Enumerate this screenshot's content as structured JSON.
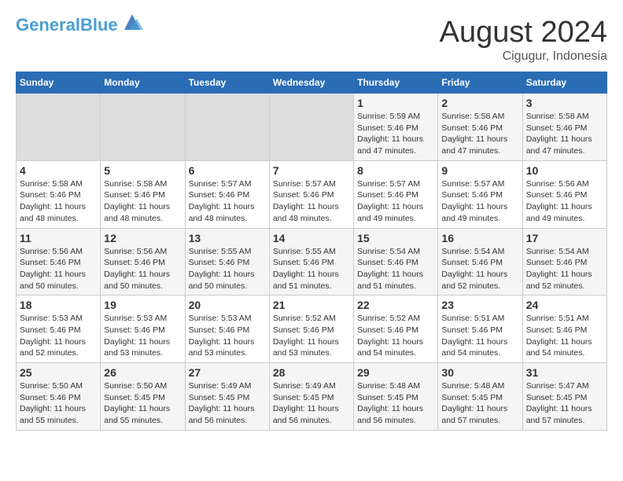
{
  "header": {
    "logo_line1": "General",
    "logo_line2": "Blue",
    "month_title": "August 2024",
    "subtitle": "Cigugur, Indonesia"
  },
  "weekdays": [
    "Sunday",
    "Monday",
    "Tuesday",
    "Wednesday",
    "Thursday",
    "Friday",
    "Saturday"
  ],
  "weeks": [
    [
      {
        "day": "",
        "info": ""
      },
      {
        "day": "",
        "info": ""
      },
      {
        "day": "",
        "info": ""
      },
      {
        "day": "",
        "info": ""
      },
      {
        "day": "1",
        "info": "Sunrise: 5:59 AM\nSunset: 5:46 PM\nDaylight: 11 hours\nand 47 minutes."
      },
      {
        "day": "2",
        "info": "Sunrise: 5:58 AM\nSunset: 5:46 PM\nDaylight: 11 hours\nand 47 minutes."
      },
      {
        "day": "3",
        "info": "Sunrise: 5:58 AM\nSunset: 5:46 PM\nDaylight: 11 hours\nand 47 minutes."
      }
    ],
    [
      {
        "day": "4",
        "info": "Sunrise: 5:58 AM\nSunset: 5:46 PM\nDaylight: 11 hours\nand 48 minutes."
      },
      {
        "day": "5",
        "info": "Sunrise: 5:58 AM\nSunset: 5:46 PM\nDaylight: 11 hours\nand 48 minutes."
      },
      {
        "day": "6",
        "info": "Sunrise: 5:57 AM\nSunset: 5:46 PM\nDaylight: 11 hours\nand 48 minutes."
      },
      {
        "day": "7",
        "info": "Sunrise: 5:57 AM\nSunset: 5:46 PM\nDaylight: 11 hours\nand 48 minutes."
      },
      {
        "day": "8",
        "info": "Sunrise: 5:57 AM\nSunset: 5:46 PM\nDaylight: 11 hours\nand 49 minutes."
      },
      {
        "day": "9",
        "info": "Sunrise: 5:57 AM\nSunset: 5:46 PM\nDaylight: 11 hours\nand 49 minutes."
      },
      {
        "day": "10",
        "info": "Sunrise: 5:56 AM\nSunset: 5:46 PM\nDaylight: 11 hours\nand 49 minutes."
      }
    ],
    [
      {
        "day": "11",
        "info": "Sunrise: 5:56 AM\nSunset: 5:46 PM\nDaylight: 11 hours\nand 50 minutes."
      },
      {
        "day": "12",
        "info": "Sunrise: 5:56 AM\nSunset: 5:46 PM\nDaylight: 11 hours\nand 50 minutes."
      },
      {
        "day": "13",
        "info": "Sunrise: 5:55 AM\nSunset: 5:46 PM\nDaylight: 11 hours\nand 50 minutes."
      },
      {
        "day": "14",
        "info": "Sunrise: 5:55 AM\nSunset: 5:46 PM\nDaylight: 11 hours\nand 51 minutes."
      },
      {
        "day": "15",
        "info": "Sunrise: 5:54 AM\nSunset: 5:46 PM\nDaylight: 11 hours\nand 51 minutes."
      },
      {
        "day": "16",
        "info": "Sunrise: 5:54 AM\nSunset: 5:46 PM\nDaylight: 11 hours\nand 52 minutes."
      },
      {
        "day": "17",
        "info": "Sunrise: 5:54 AM\nSunset: 5:46 PM\nDaylight: 11 hours\nand 52 minutes."
      }
    ],
    [
      {
        "day": "18",
        "info": "Sunrise: 5:53 AM\nSunset: 5:46 PM\nDaylight: 11 hours\nand 52 minutes."
      },
      {
        "day": "19",
        "info": "Sunrise: 5:53 AM\nSunset: 5:46 PM\nDaylight: 11 hours\nand 53 minutes."
      },
      {
        "day": "20",
        "info": "Sunrise: 5:53 AM\nSunset: 5:46 PM\nDaylight: 11 hours\nand 53 minutes."
      },
      {
        "day": "21",
        "info": "Sunrise: 5:52 AM\nSunset: 5:46 PM\nDaylight: 11 hours\nand 53 minutes."
      },
      {
        "day": "22",
        "info": "Sunrise: 5:52 AM\nSunset: 5:46 PM\nDaylight: 11 hours\nand 54 minutes."
      },
      {
        "day": "23",
        "info": "Sunrise: 5:51 AM\nSunset: 5:46 PM\nDaylight: 11 hours\nand 54 minutes."
      },
      {
        "day": "24",
        "info": "Sunrise: 5:51 AM\nSunset: 5:46 PM\nDaylight: 11 hours\nand 54 minutes."
      }
    ],
    [
      {
        "day": "25",
        "info": "Sunrise: 5:50 AM\nSunset: 5:46 PM\nDaylight: 11 hours\nand 55 minutes."
      },
      {
        "day": "26",
        "info": "Sunrise: 5:50 AM\nSunset: 5:45 PM\nDaylight: 11 hours\nand 55 minutes."
      },
      {
        "day": "27",
        "info": "Sunrise: 5:49 AM\nSunset: 5:45 PM\nDaylight: 11 hours\nand 56 minutes."
      },
      {
        "day": "28",
        "info": "Sunrise: 5:49 AM\nSunset: 5:45 PM\nDaylight: 11 hours\nand 56 minutes."
      },
      {
        "day": "29",
        "info": "Sunrise: 5:48 AM\nSunset: 5:45 PM\nDaylight: 11 hours\nand 56 minutes."
      },
      {
        "day": "30",
        "info": "Sunrise: 5:48 AM\nSunset: 5:45 PM\nDaylight: 11 hours\nand 57 minutes."
      },
      {
        "day": "31",
        "info": "Sunrise: 5:47 AM\nSunset: 5:45 PM\nDaylight: 11 hours\nand 57 minutes."
      }
    ]
  ]
}
